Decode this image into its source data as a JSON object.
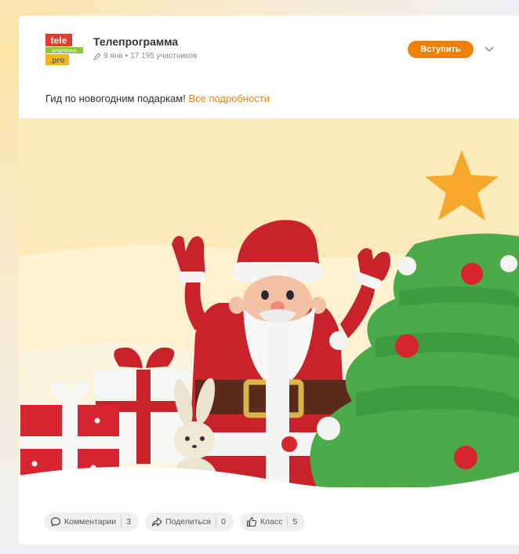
{
  "group": {
    "name": "Телепрограмма",
    "logo_text_top": "tele",
    "logo_text_mid": "programma",
    "logo_text_bottom": ".pro",
    "date": "9 янв",
    "members": "17 195 участников",
    "join_label": "Вступить"
  },
  "post": {
    "text": "Гид по новогодним подаркам!",
    "link": "Все подробности"
  },
  "actions": {
    "comments_label": "Комментарии",
    "comments_count": "3",
    "share_label": "Поделиться",
    "share_count": "0",
    "like_label": "Класс",
    "like_count": "5"
  },
  "colors": {
    "accent": "#ee8208",
    "image_background": "#fcebb8"
  },
  "icons": {
    "edit": "pencil-icon",
    "menu": "chevron-down-icon",
    "comments": "speech-bubble-icon",
    "share": "share-arrow-icon",
    "like": "thumbs-up-icon"
  }
}
